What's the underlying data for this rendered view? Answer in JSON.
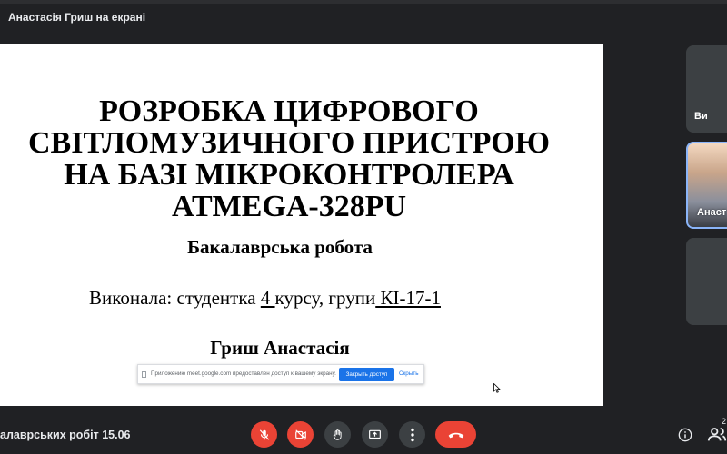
{
  "topbar": {
    "presenter_label": "Анастасія Гриш на екрані"
  },
  "slide": {
    "title_lines": [
      "РОЗРОБКА ЦИФРОВОГО",
      "СВІТЛОМУЗИЧНОГО ПРИСТРОЮ",
      "НА БАЗІ МІКРОКОНТРОЛЕРА",
      "ATMEGA-328PU"
    ],
    "subtitle": "Бакалаврська робота",
    "performed_prefix": "Виконала: студентка ",
    "course": " 4 ",
    "performed_middle": " курсу, групи",
    "group": " КІ-17-1",
    "author": "Гриш Анастасія"
  },
  "share_notice": {
    "text": "Приложению meet.google.com предоставлен доступ к вашему экрану.",
    "stop_button": "Закрыть доступ",
    "hide_link": "Скрыть"
  },
  "participants": [
    {
      "label": "Ви"
    },
    {
      "label": "Анаст"
    },
    {
      "label": ""
    }
  ],
  "bottombar": {
    "meeting_name": "алаврських робіт 15.06",
    "participant_count": "2"
  },
  "icons": {
    "mic": "mic-off-icon",
    "camera": "camera-off-icon",
    "hand": "raise-hand-icon",
    "present": "present-screen-icon",
    "more": "more-vert-icon",
    "hangup": "call-end-icon",
    "info": "info-icon",
    "people": "people-icon"
  },
  "colors": {
    "accent": "#1a73e8",
    "danger": "#ea4335",
    "bar": "#202124",
    "tile": "#3c4043"
  }
}
